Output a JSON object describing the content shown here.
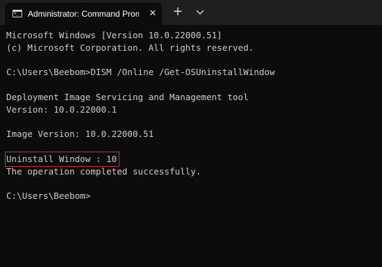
{
  "tab": {
    "title": "Administrator: Command Prom",
    "icon": "terminal-icon",
    "close_icon": "close-icon",
    "close_glyph": "✕"
  },
  "toolbar": {
    "new_tab_glyph": "+",
    "new_tab_icon": "plus-icon",
    "dropdown_icon": "chevron-down-icon"
  },
  "console": {
    "lines": [
      "Microsoft Windows [Version 10.0.22000.51]",
      "(c) Microsoft Corporation. All rights reserved.",
      "",
      "C:\\Users\\Beebom>DISM /Online /Get-OSUninstallWindow",
      "",
      "Deployment Image Servicing and Management tool",
      "Version: 10.0.22000.1",
      "",
      "Image Version: 10.0.22000.51",
      "",
      "Uninstall Window : 10",
      "The operation completed successfully.",
      "",
      "C:\\Users\\Beebom>"
    ],
    "highlighted_line_index": 10
  },
  "colors": {
    "background": "#0c0c0c",
    "tabbar": "#1e1e1e",
    "text": "#cccccc",
    "highlight_border": "#c0392b"
  }
}
